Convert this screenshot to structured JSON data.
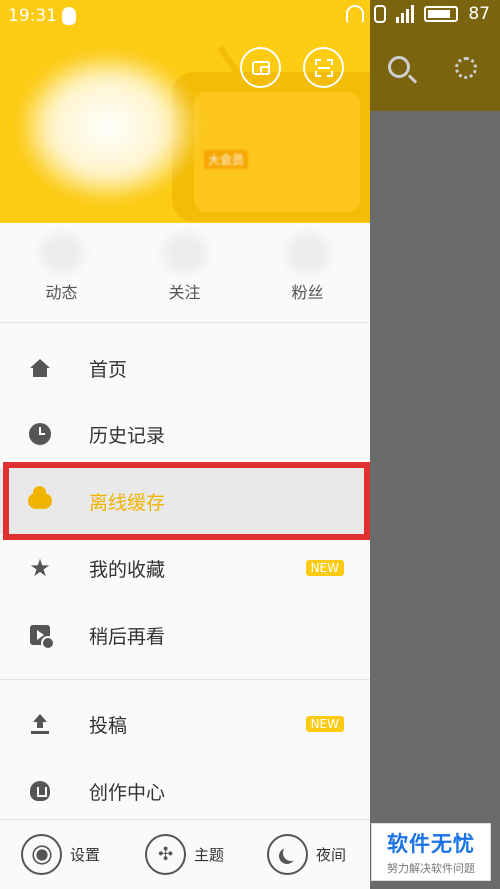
{
  "status_bar": {
    "time": "19:31",
    "battery": "87",
    "icons": [
      "qq-icon",
      "headset-icon",
      "vibrate-icon",
      "signal-icon",
      "battery-icon"
    ]
  },
  "drawer": {
    "header": {
      "vip_badge": "大会员",
      "buttons": [
        "wallet-icon",
        "scan-icon"
      ]
    },
    "stats": [
      {
        "label": "动态"
      },
      {
        "label": "关注"
      },
      {
        "label": "粉丝"
      }
    ],
    "menu": [
      {
        "label": "首页",
        "icon": "home-icon"
      },
      {
        "label": "历史记录",
        "icon": "clock-icon"
      },
      {
        "label": "离线缓存",
        "icon": "cloud-download-icon",
        "active": true
      },
      {
        "label": "我的收藏",
        "icon": "star-icon",
        "badge": "NEW"
      },
      {
        "label": "稍后再看",
        "icon": "watch-later-icon"
      },
      {
        "label": "投稿",
        "icon": "upload-icon",
        "badge": "NEW"
      },
      {
        "label": "创作中心",
        "icon": "bulb-icon"
      }
    ],
    "bottom": [
      {
        "label": "设置",
        "icon": "gear-icon"
      },
      {
        "label": "主题",
        "icon": "theme-icon"
      },
      {
        "label": "夜间",
        "icon": "moon-icon"
      }
    ]
  },
  "background_header_icons": [
    "search-icon",
    "settings-icon"
  ],
  "watermark": {
    "title": "软件无忧",
    "subtitle": "努力解决软件问题"
  },
  "colors": {
    "accent": "#fccb12",
    "active_text": "#f0b400",
    "highlight_border": "#e03131"
  }
}
